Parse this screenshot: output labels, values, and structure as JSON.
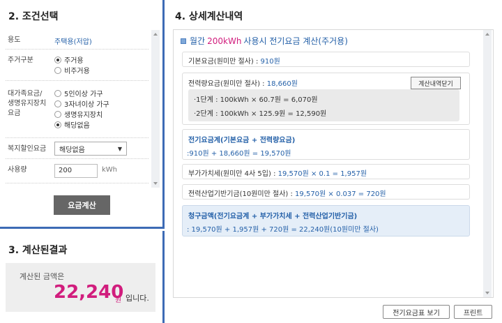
{
  "left": {
    "title": "2. 조건선택",
    "usage": {
      "label": "용도",
      "value": "주택용(저압)"
    },
    "residence": {
      "label": "주거구분",
      "options": [
        "주거용",
        "비주거용"
      ],
      "selected": "주거용"
    },
    "discount_type": {
      "label": "대가족요금/ 생명유지장치 요금",
      "options": [
        "5인이상 가구",
        "3자녀이상 가구",
        "생명유지장치",
        "해당없음"
      ],
      "selected": "해당없음"
    },
    "welfare": {
      "label": "복지할인요금",
      "value": "해당없음"
    },
    "usage_amount": {
      "label": "사용량",
      "value": "200",
      "unit": "kWh"
    },
    "calc_button": "요금계산"
  },
  "result": {
    "title": "3. 계산된결과",
    "caption": "계산된 금액은",
    "amount": "22,240",
    "unit": "원",
    "suffix": "입니다."
  },
  "detail": {
    "title": "4. 상세계산내역",
    "subtitle_prefix": "월간",
    "subtitle_highlight": "200kWh",
    "subtitle_rest": "사용시 전기요금 계산(주거용)",
    "base_fee_label": "기본요금(원미만 절사) :",
    "base_fee_value": "910원",
    "energy_fee_label": "전력량요금(원미만 절사) :",
    "energy_fee_value": "18,660원",
    "detail_button": "계산내역닫기",
    "step1": "·1단계 : 100kWh × 60.7원 = 6,070원",
    "step2": "·2단계 : 100kWh × 125.9원 = 12,590원",
    "elec_total_heading": "전기요금계(기본요금 + 전력량요금)",
    "elec_total_formula": ":910원 + 18,660원 = 19,570원",
    "vat_label": "부가가치세(원미만 4사 5입) :",
    "vat_formula": "19,570원 × 0.1 = 1,957원",
    "fund_label": "전력산업기반기금(10원미만 절사) :",
    "fund_formula": "19,570원 × 0.037 = 720원",
    "bill_heading": "청구금액(전기요금계 + 부가가치세 + 전력산업기반기금)",
    "bill_formula": ": 19,570원 + 1,957원 + 720원 = 22,240원(10원미만 절사)",
    "table_button": "전기요금표 보기",
    "print_button": "프린트"
  },
  "colors": {
    "accent_blue": "#3d6bb5",
    "pink": "#d11d7d",
    "link_blue": "#2460a8"
  }
}
